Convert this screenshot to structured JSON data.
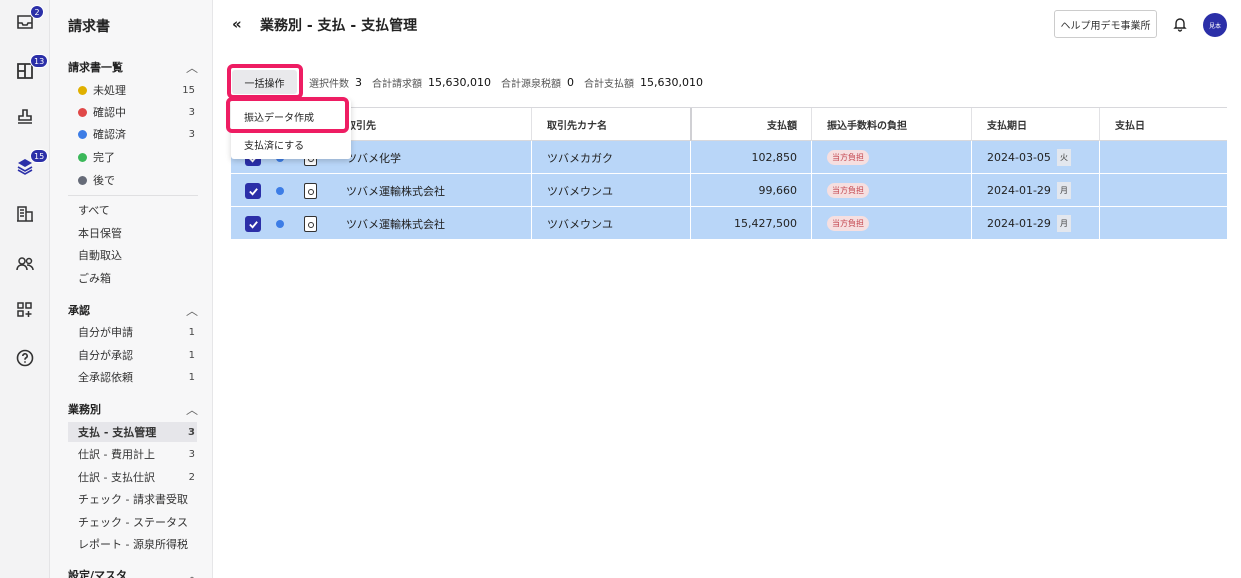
{
  "rail": {
    "items": [
      {
        "icon": "inbox-icon",
        "badge": "2"
      },
      {
        "icon": "layout-icon",
        "badge": "13"
      },
      {
        "icon": "stamp-icon",
        "badge": ""
      },
      {
        "icon": "layers-icon",
        "badge": "15"
      },
      {
        "icon": "building-icon",
        "badge": ""
      },
      {
        "icon": "users-icon",
        "badge": ""
      },
      {
        "icon": "apps-add-icon",
        "badge": ""
      },
      {
        "icon": "help-icon",
        "badge": ""
      }
    ]
  },
  "sidebar": {
    "title": "請求書",
    "sections": {
      "invoice_list": {
        "label": "請求書一覧"
      },
      "approval": {
        "label": "承認"
      },
      "business": {
        "label": "業務別"
      },
      "settings": {
        "label": "設定/マスタ"
      }
    },
    "status_items": [
      {
        "label": "未処理",
        "count": "15",
        "color": "#e0b000"
      },
      {
        "label": "確認中",
        "count": "3",
        "color": "#e04848"
      },
      {
        "label": "確認済",
        "count": "3",
        "color": "#3d7de6"
      },
      {
        "label": "完了",
        "count": "",
        "color": "#3bb85a"
      },
      {
        "label": "後で",
        "count": "",
        "color": "#666b78"
      }
    ],
    "filter_items": [
      {
        "label": "すべて"
      },
      {
        "label": "本日保管"
      },
      {
        "label": "自動取込"
      },
      {
        "label": "ごみ箱"
      }
    ],
    "approval_items": [
      {
        "label": "自分が申請",
        "count": "1"
      },
      {
        "label": "自分が承認",
        "count": "1"
      },
      {
        "label": "全承認依頼",
        "count": "1"
      }
    ],
    "business_items": [
      {
        "label": "支払 - 支払管理",
        "count": "3"
      },
      {
        "label": "仕訳 - 費用計上",
        "count": "3"
      },
      {
        "label": "仕訳 - 支払仕訳",
        "count": "2"
      },
      {
        "label": "チェック - 請求書受取",
        "count": ""
      },
      {
        "label": "チェック - ステータス",
        "count": ""
      },
      {
        "label": "レポート - 源泉所得税",
        "count": ""
      }
    ]
  },
  "header": {
    "title": "業務別 - 支払 - 支払管理",
    "help_button": "ヘルプ用デモ事業所",
    "avatar_text": "見本"
  },
  "toolbar": {
    "bulk_button": "一括操作",
    "selected_label": "選択件数",
    "selected_value": "3",
    "total_invoice_label": "合計請求額",
    "total_invoice_value": "15,630,010",
    "total_withholding_label": "合計源泉税額",
    "total_withholding_value": "0",
    "total_payment_label": "合計支払額",
    "total_payment_value": "15,630,010"
  },
  "dropdown": {
    "items": [
      "振込データ作成",
      "支払済にする"
    ]
  },
  "table": {
    "columns": [
      "取引先",
      "取引先カナ名",
      "支払額",
      "振込手数料の負担",
      "支払期日",
      "支払日"
    ],
    "rows": [
      {
        "vendor": "ツバメ化学",
        "kana": "ツバメカガク",
        "amount": "102,850",
        "fee": "当方負担",
        "due": "2024-03-05",
        "day": "火",
        "paid": ""
      },
      {
        "vendor": "ツバメ運輸株式会社",
        "kana": "ツバメウンユ",
        "amount": "99,660",
        "fee": "当方負担",
        "due": "2024-01-29",
        "day": "月",
        "paid": ""
      },
      {
        "vendor": "ツバメ運輸株式会社",
        "kana": "ツバメウンユ",
        "amount": "15,427,500",
        "fee": "当方負担",
        "due": "2024-01-29",
        "day": "月",
        "paid": ""
      }
    ]
  }
}
